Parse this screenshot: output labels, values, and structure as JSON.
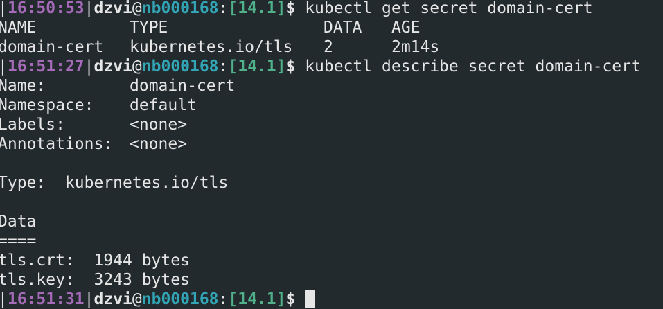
{
  "prompts": [
    {
      "time": "16:50:53",
      "user": "dzvi",
      "host": "nb000168",
      "version": "[14.1]",
      "symbol": "$",
      "command": " kubectl get secret domain-cert"
    },
    {
      "time": "16:51:27",
      "user": "dzvi",
      "host": "nb000168",
      "version": "[14.1]",
      "symbol": "$",
      "command": " kubectl describe secret domain-cert"
    },
    {
      "time": "16:51:31",
      "user": "dzvi",
      "host": "nb000168",
      "version": "[14.1]",
      "symbol": "$",
      "command": " "
    }
  ],
  "get_output": {
    "headers": [
      "NAME",
      "TYPE",
      "DATA",
      "AGE"
    ],
    "row": [
      "domain-cert",
      "kubernetes.io/tls",
      "2",
      "2m14s"
    ]
  },
  "describe_output": {
    "name_key": "Name:",
    "name_val": "domain-cert",
    "namespace_key": "Namespace:",
    "namespace_val": "default",
    "labels_key": "Labels:",
    "labels_val": "<none>",
    "annotations_key": "Annotations:",
    "annotations_val": "<none>",
    "type_line": "Type:  kubernetes.io/tls",
    "data_heading": "Data",
    "data_rule": "====",
    "crt_line": "tls.crt:  1944 bytes",
    "key_line": "tls.key:  3243 bytes"
  },
  "colors": {
    "background": "#232a2e",
    "foreground": "#e6e6e6",
    "time": "#a56ab8",
    "host": "#32a6b6",
    "version": "#4fb08a"
  }
}
